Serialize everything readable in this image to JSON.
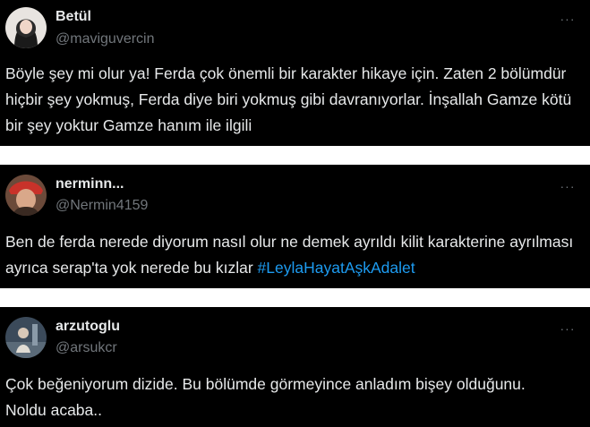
{
  "tweets": [
    {
      "author_name": "Betül",
      "handle": "@maviguvercin",
      "text": "Böyle şey mi olur ya! Ferda çok önemli bir karakter hikaye için. Zaten 2 bölümdür hiçbir şey yokmuş, Ferda diye biri yokmuş gibi davranıyorlar. İnşallah Gamze kötü bir şey yoktur Gamze hanım ile ilgili"
    },
    {
      "author_name": "nerminn...",
      "handle": "@Nermin4159",
      "text": "Ben de ferda nerede diyorum nasıl olur ne demek ayrıldı kilit karakterine ayrılması ayrıca serap'ta yok nerede bu kızlar ",
      "hashtag": "#LeylaHayatAşkAdalet"
    },
    {
      "author_name": "arzutoglu",
      "handle": "@arsukcr",
      "text": "Çok beğeniyorum dizide. Bu bölümde görmeyince anladım bişey olduğunu. Noldu acaba.."
    }
  ],
  "more_icon": "more-horizontal-icon",
  "colors": {
    "background": "#000000",
    "text": "#e7e9ea",
    "secondary": "#71767b",
    "hashtag": "#1d9bf0"
  }
}
